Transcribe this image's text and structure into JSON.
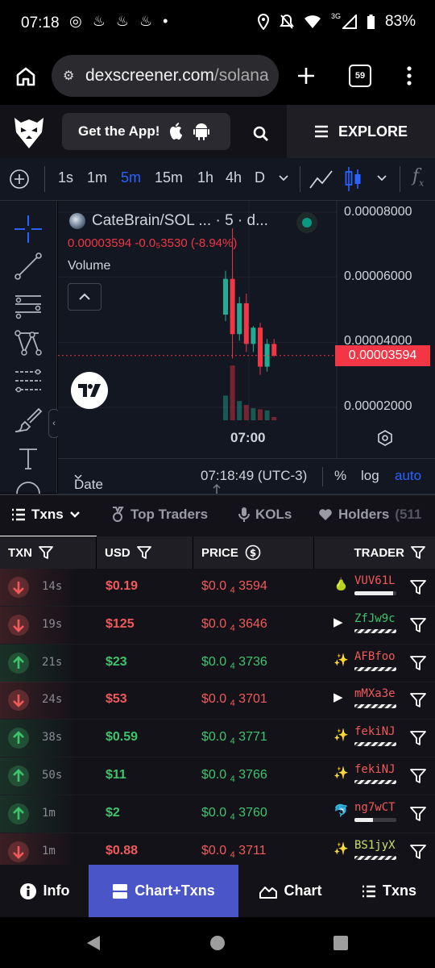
{
  "status_bar": {
    "time": "07:18",
    "notif_icons": "◎ ♨ ♨ ♨ •",
    "network": "3G",
    "battery": "83%"
  },
  "browser": {
    "url_domain": "dexscreener.com",
    "url_path": "/solana",
    "tab_count": "59"
  },
  "app_header": {
    "get_app_label": "Get the App!",
    "explore_label": "EXPLORE"
  },
  "chart_toolbar": {
    "timeframes": [
      "1s",
      "1m",
      "5m",
      "15m",
      "1h",
      "4h",
      "D"
    ],
    "active_timeframe": "5m"
  },
  "chart": {
    "pair_title": "CateBrain/SOL ... · 5 · d...",
    "ohlc_line": "0.00003594  -0.0₅3530 (-8.94%)",
    "volume_label": "Volume",
    "y_labels": [
      "0.00008000",
      "0.00006000",
      "0.00004000",
      "0.00002000"
    ],
    "current_price_tag": "0.00003594",
    "time_label": "07:00",
    "date_range_label": "Date Range",
    "clock": "07:18:49 (UTC-3)",
    "percent_label": "%",
    "log_label": "log",
    "auto_label": "auto"
  },
  "chart_data": {
    "type": "candlestick",
    "y_axis_labels": [
      "0.00008000",
      "0.00006000",
      "0.00004000",
      "0.00002000"
    ],
    "x_axis_labels": [
      "07:00"
    ],
    "last_price": "0.00003594",
    "candles": [
      {
        "open": 4.85e-05,
        "close": 5.95e-05,
        "high": 6.2e-05,
        "low": 4.65e-05,
        "up": true,
        "vol": 0.45
      },
      {
        "open": 5.95e-05,
        "close": 4.25e-05,
        "high": 7.5e-05,
        "low": 3.5e-05,
        "up": false,
        "vol": 1.0
      },
      {
        "open": 4.25e-05,
        "close": 5.2e-05,
        "high": 5.4e-05,
        "low": 4.05e-05,
        "up": true,
        "vol": 0.35
      },
      {
        "open": 5.2e-05,
        "close": 3.95e-05,
        "high": 5.5e-05,
        "low": 3.7e-05,
        "up": false,
        "vol": 0.28
      },
      {
        "open": 3.95e-05,
        "close": 4.45e-05,
        "high": 4.5e-05,
        "low": 3.7e-05,
        "up": true,
        "vol": 0.22
      },
      {
        "open": 4.45e-05,
        "close": 3.25e-05,
        "high": 4.6e-05,
        "low": 3e-05,
        "up": false,
        "vol": 0.2
      },
      {
        "open": 3.25e-05,
        "close": 3.95e-05,
        "high": 4.1e-05,
        "low": 3.1e-05,
        "up": true,
        "vol": 0.18
      },
      {
        "open": 3.95e-05,
        "close": 3.59e-05,
        "high": 4.1e-05,
        "low": 3.55e-05,
        "up": false,
        "vol": 0.06
      }
    ]
  },
  "txns_tabs": {
    "txns": "Txns",
    "top_traders": "Top Traders",
    "kols": "KOLs",
    "holders": "Holders",
    "holders_count": "(511"
  },
  "table": {
    "headers": {
      "txn": "TXN",
      "usd": "USD",
      "price": "PRICE",
      "trader": "TRADER"
    },
    "rows": [
      {
        "type": "sell",
        "age": "14s",
        "usd": "$0.19",
        "price_prefix": "$0.0",
        "price_sub": "4",
        "price_rest": "3594",
        "trader": "VUV61L",
        "trader_color": "#f15a5a",
        "icon": "🍐",
        "bar_pct": 0.92,
        "hatch": false
      },
      {
        "type": "sell",
        "age": "19s",
        "usd": "$125",
        "price_prefix": "$0.0",
        "price_sub": "4",
        "price_rest": "3646",
        "trader": "ZfJw9c",
        "trader_color": "#3ec46d",
        "icon": "▶",
        "bar_pct": 0.0,
        "hatch": true
      },
      {
        "type": "buy",
        "age": "21s",
        "usd": "$23",
        "price_prefix": "$0.0",
        "price_sub": "4",
        "price_rest": "3736",
        "trader": "AFBfoo",
        "trader_color": "#f15a5a",
        "icon": "✨",
        "bar_pct": 0.0,
        "hatch": true
      },
      {
        "type": "sell",
        "age": "24s",
        "usd": "$53",
        "price_prefix": "$0.0",
        "price_sub": "4",
        "price_rest": "3701",
        "trader": "mMXa3e",
        "trader_color": "#f15a5a",
        "icon": "▶",
        "bar_pct": 0.0,
        "hatch": true
      },
      {
        "type": "buy",
        "age": "38s",
        "usd": "$0.59",
        "price_prefix": "$0.0",
        "price_sub": "4",
        "price_rest": "3771",
        "trader": "fekiNJ",
        "trader_color": "#f15a5a",
        "icon": "✨",
        "bar_pct": 0.0,
        "hatch": true
      },
      {
        "type": "buy",
        "age": "50s",
        "usd": "$11",
        "price_prefix": "$0.0",
        "price_sub": "4",
        "price_rest": "3766",
        "trader": "fekiNJ",
        "trader_color": "#f15a5a",
        "icon": "✨",
        "bar_pct": 0.0,
        "hatch": true
      },
      {
        "type": "buy",
        "age": "1m",
        "usd": "$2",
        "price_prefix": "$0.0",
        "price_sub": "4",
        "price_rest": "3760",
        "trader": "ng7wCT",
        "trader_color": "#f15a5a",
        "icon": "🐬",
        "bar_pct": 0.45,
        "hatch": false
      },
      {
        "type": "sell",
        "age": "1m",
        "usd": "$0.88",
        "price_prefix": "$0.0",
        "price_sub": "4",
        "price_rest": "3711",
        "trader": "BS1jyX",
        "trader_color": "#c8e06a",
        "icon": "✨",
        "bar_pct": 0.0,
        "hatch": true
      }
    ]
  },
  "bottom_nav": {
    "info": "Info",
    "chart_txns": "Chart+Txns",
    "chart": "Chart",
    "txns": "Txns",
    "active": "chart_txns"
  },
  "colors": {
    "buy": "#3ec46d",
    "sell": "#f15a5a",
    "accent": "#2962ff",
    "active_nav": "#4a55c8"
  }
}
